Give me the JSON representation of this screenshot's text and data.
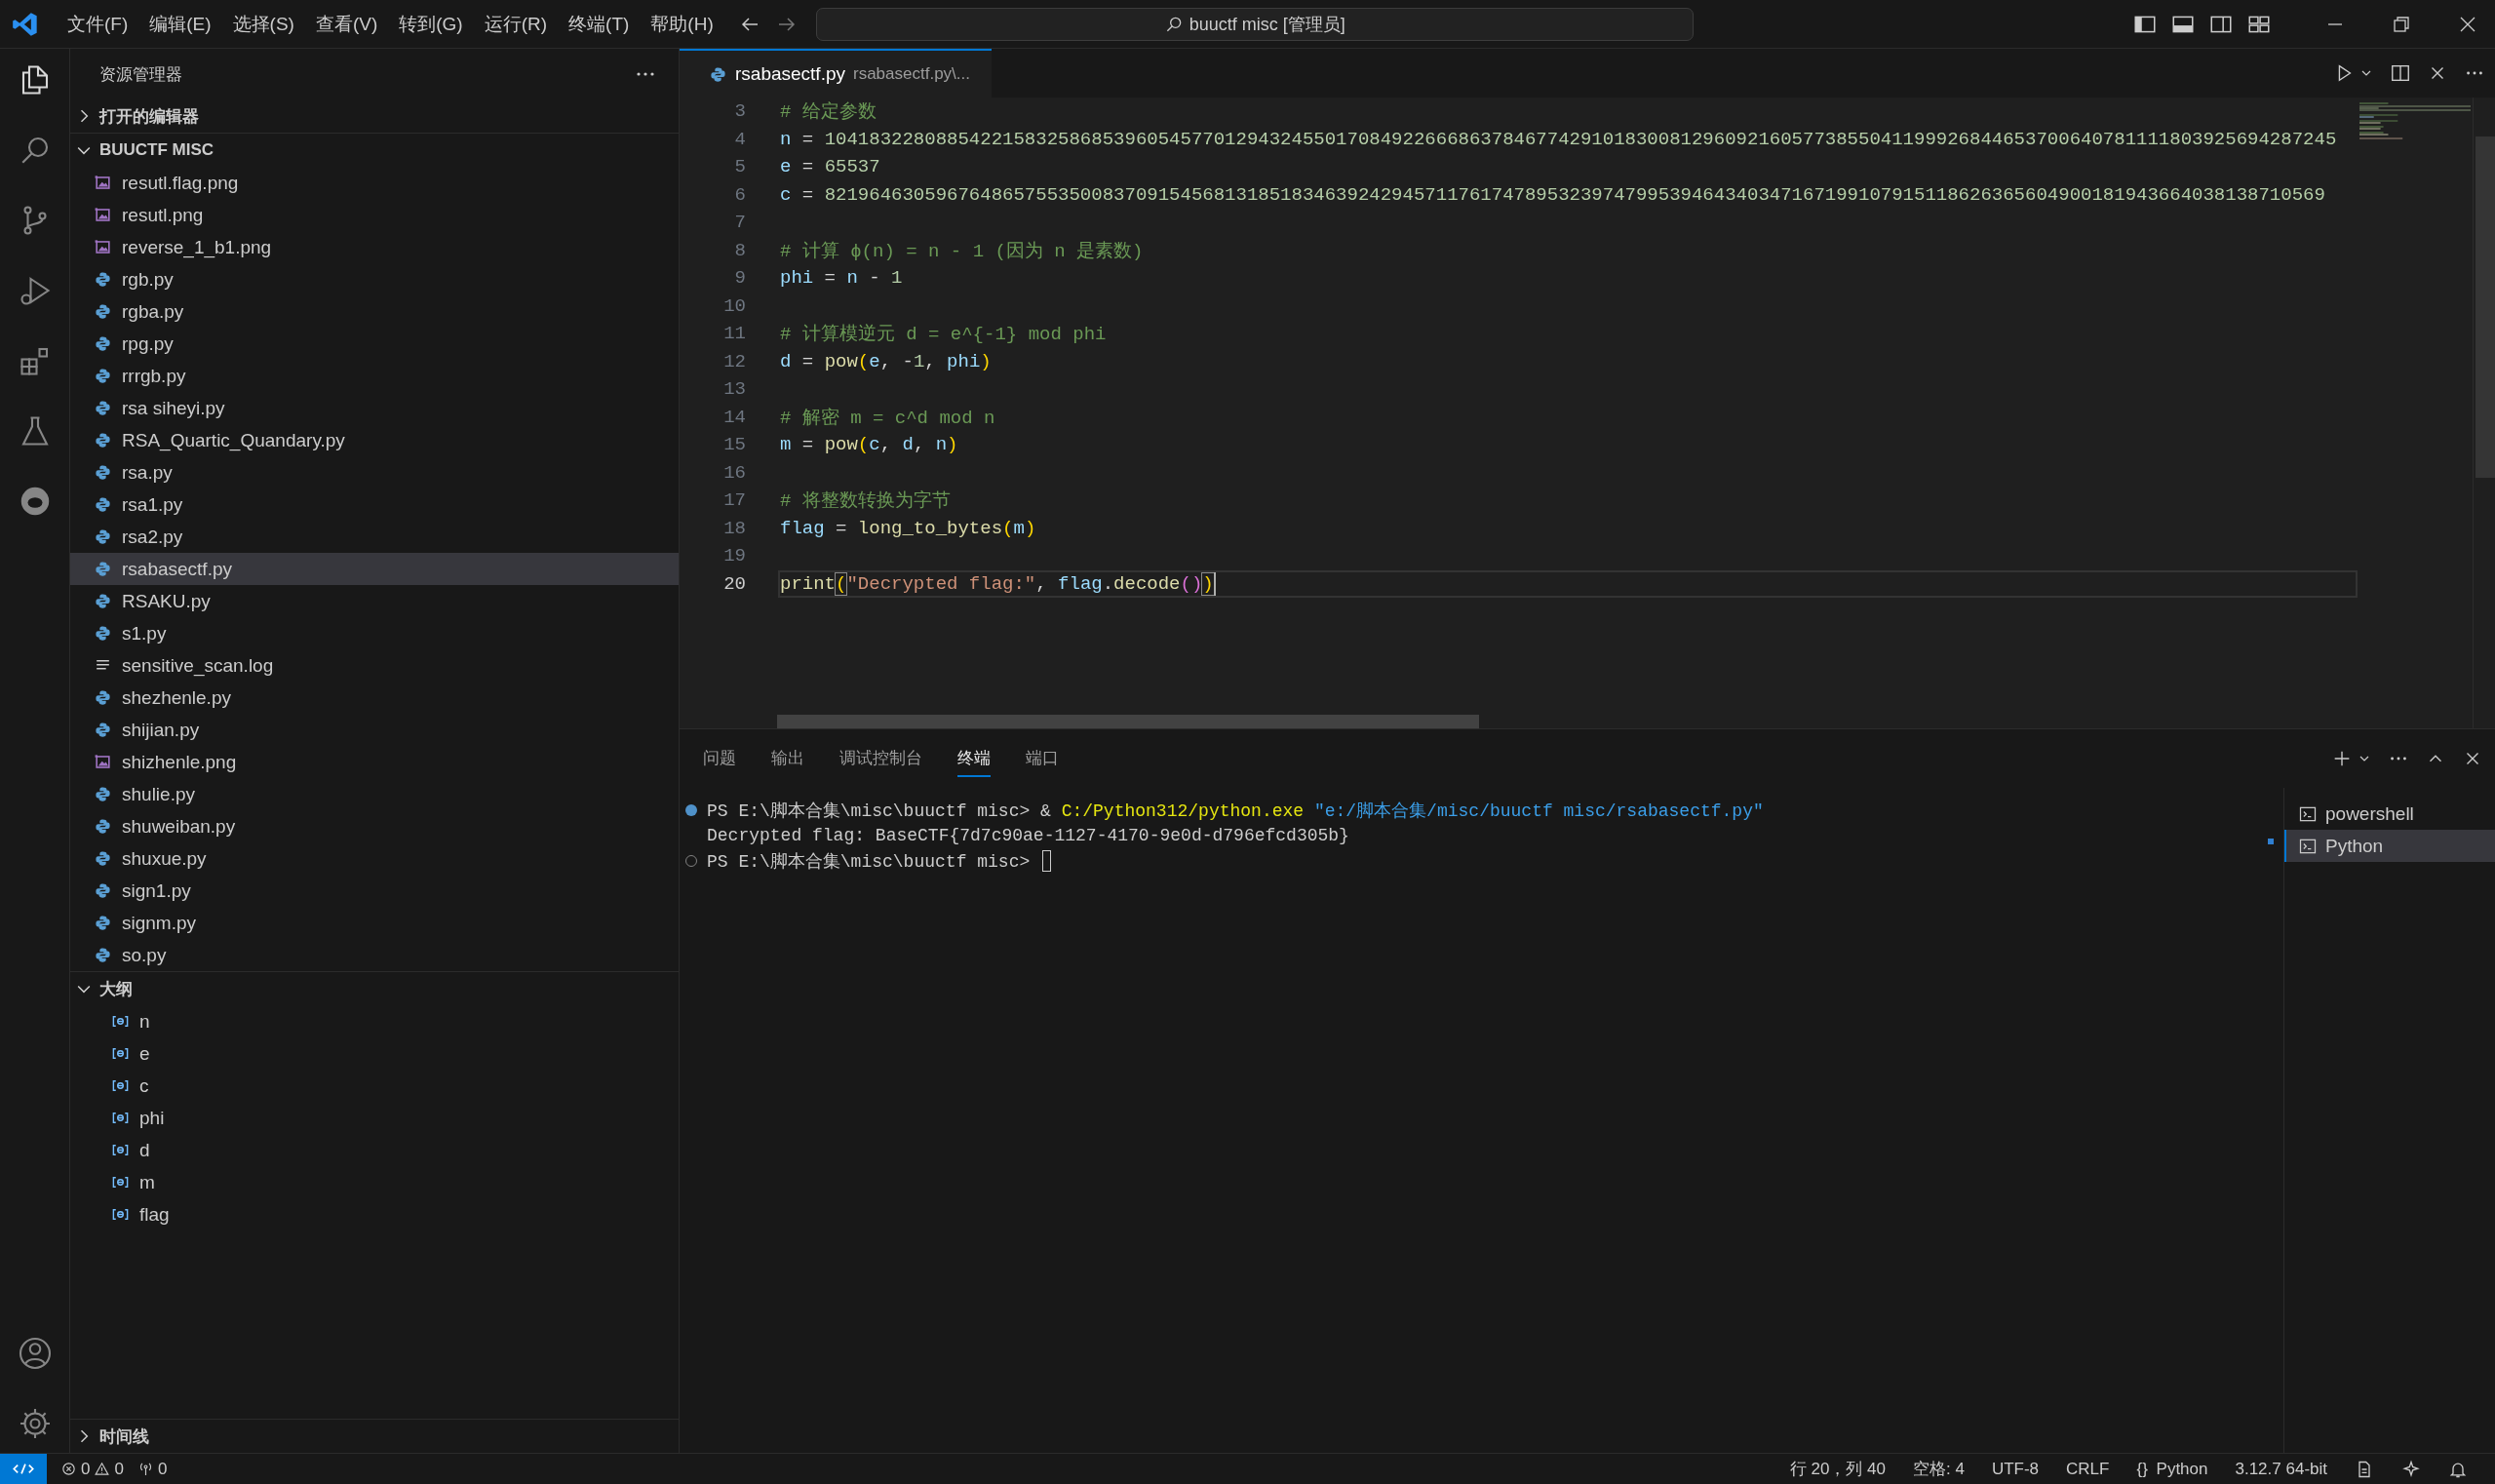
{
  "title_bar": {
    "menu": [
      "文件(F)",
      "编辑(E)",
      "选择(S)",
      "查看(V)",
      "转到(G)",
      "运行(R)",
      "终端(T)",
      "帮助(H)"
    ],
    "search": "buuctf misc [管理员]"
  },
  "activity_bar": {
    "top": [
      {
        "kind": "explorer",
        "selected": true
      },
      {
        "kind": "search",
        "selected": false
      },
      {
        "kind": "source-control",
        "selected": false
      },
      {
        "kind": "run-debug",
        "selected": false
      },
      {
        "kind": "extensions",
        "selected": false
      },
      {
        "kind": "testing",
        "selected": false
      },
      {
        "kind": "assistant",
        "selected": false
      }
    ],
    "bottom": [
      {
        "kind": "account",
        "selected": false
      },
      {
        "kind": "settings",
        "selected": false
      }
    ]
  },
  "sidebar": {
    "title": "资源管理器",
    "open_editors": {
      "label": "打开的编辑器",
      "expanded": false
    },
    "folder": {
      "label": "BUUCTF MISC",
      "expanded": true,
      "items": [
        {
          "name": "resutl.flag.png",
          "kind": "image",
          "selected": false
        },
        {
          "name": "resutl.png",
          "kind": "image",
          "selected": false
        },
        {
          "name": "reverse_1_b1.png",
          "kind": "image",
          "selected": false
        },
        {
          "name": "rgb.py",
          "kind": "python",
          "selected": false
        },
        {
          "name": "rgba.py",
          "kind": "python",
          "selected": false
        },
        {
          "name": "rpg.py",
          "kind": "python",
          "selected": false
        },
        {
          "name": "rrrgb.py",
          "kind": "python",
          "selected": false
        },
        {
          "name": "rsa siheyi.py",
          "kind": "python",
          "selected": false
        },
        {
          "name": "RSA_Quartic_Quandary.py",
          "kind": "python",
          "selected": false
        },
        {
          "name": "rsa.py",
          "kind": "python",
          "selected": false
        },
        {
          "name": "rsa1.py",
          "kind": "python",
          "selected": false
        },
        {
          "name": "rsa2.py",
          "kind": "python",
          "selected": false
        },
        {
          "name": "rsabasectf.py",
          "kind": "python",
          "selected": true
        },
        {
          "name": "RSAKU.py",
          "kind": "python",
          "selected": false
        },
        {
          "name": "s1.py",
          "kind": "python",
          "selected": false
        },
        {
          "name": "sensitive_scan.log",
          "kind": "log",
          "selected": false
        },
        {
          "name": "shezhenle.py",
          "kind": "python",
          "selected": false
        },
        {
          "name": "shijian.py",
          "kind": "python",
          "selected": false
        },
        {
          "name": "shizhenle.png",
          "kind": "image",
          "selected": false
        },
        {
          "name": "shulie.py",
          "kind": "python",
          "selected": false
        },
        {
          "name": "shuweiban.py",
          "kind": "python",
          "selected": false
        },
        {
          "name": "shuxue.py",
          "kind": "python",
          "selected": false
        },
        {
          "name": "sign1.py",
          "kind": "python",
          "selected": false
        },
        {
          "name": "signm.py",
          "kind": "python",
          "selected": false
        },
        {
          "name": "so.py",
          "kind": "python",
          "selected": false
        }
      ]
    },
    "outline": {
      "label": "大纲",
      "expanded": true,
      "items": [
        "n",
        "e",
        "c",
        "phi",
        "d",
        "m",
        "flag"
      ]
    },
    "timeline": {
      "label": "时间线",
      "expanded": false
    }
  },
  "editor": {
    "tab": {
      "name": "rsabasectf.py",
      "path": "rsabasectf.py\\..."
    },
    "lines": [
      {
        "number": "3",
        "current": false,
        "tokens": [
          {
            "text": "# 给定参数",
            "kind": "comment"
          }
        ]
      },
      {
        "number": "4",
        "current": false,
        "tokens": [
          {
            "text": "n",
            "kind": "var"
          },
          {
            "text": " = ",
            "kind": "op"
          },
          {
            "text": "1041832280885422158325868539605457701294324550170849226668637846774291018300812960921605773855041199926844653700640781111803925694287245",
            "kind": "num"
          }
        ]
      },
      {
        "number": "5",
        "current": false,
        "tokens": [
          {
            "text": "e",
            "kind": "var"
          },
          {
            "text": " = ",
            "kind": "op"
          },
          {
            "text": "65537",
            "kind": "num"
          }
        ]
      },
      {
        "number": "6",
        "current": false,
        "tokens": [
          {
            "text": "c",
            "kind": "var"
          },
          {
            "text": " = ",
            "kind": "op"
          },
          {
            "text": "821964630596764865755350083709154568131851834639242945711761747895323974799539464340347167199107915118626365604900181943664038138710569",
            "kind": "num"
          }
        ]
      },
      {
        "number": "7",
        "current": false
      },
      {
        "number": "8",
        "current": false,
        "tokens": [
          {
            "text": "# 计算 ϕ(n) = n - 1 (因为 n 是素数)",
            "kind": "comment"
          }
        ]
      },
      {
        "number": "9",
        "current": false,
        "tokens": [
          {
            "text": "phi",
            "kind": "var"
          },
          {
            "text": " = ",
            "kind": "op"
          },
          {
            "text": "n",
            "kind": "var"
          },
          {
            "text": " - ",
            "kind": "op"
          },
          {
            "text": "1",
            "kind": "num"
          }
        ]
      },
      {
        "number": "10",
        "current": false
      },
      {
        "number": "11",
        "current": false,
        "tokens": [
          {
            "text": "# 计算模逆元 d = e^{-1} mod phi",
            "kind": "comment"
          }
        ]
      },
      {
        "number": "12",
        "current": false,
        "tokens": [
          {
            "text": "d",
            "kind": "var"
          },
          {
            "text": " = ",
            "kind": "op"
          },
          {
            "text": "pow",
            "kind": "fn"
          },
          {
            "text": "(",
            "kind": "bracket"
          },
          {
            "text": "e",
            "kind": "var"
          },
          {
            "text": ", -",
            "kind": "op"
          },
          {
            "text": "1",
            "kind": "num"
          },
          {
            "text": ", ",
            "kind": "op"
          },
          {
            "text": "phi",
            "kind": "var"
          },
          {
            "text": ")",
            "kind": "bracket"
          }
        ]
      },
      {
        "number": "13",
        "current": false
      },
      {
        "number": "14",
        "current": false,
        "tokens": [
          {
            "text": "# 解密 m = c^d mod n",
            "kind": "comment"
          }
        ]
      },
      {
        "number": "15",
        "current": false,
        "tokens": [
          {
            "text": "m",
            "kind": "var"
          },
          {
            "text": " = ",
            "kind": "op"
          },
          {
            "text": "pow",
            "kind": "fn"
          },
          {
            "text": "(",
            "kind": "bracket"
          },
          {
            "text": "c",
            "kind": "var"
          },
          {
            "text": ", ",
            "kind": "op"
          },
          {
            "text": "d",
            "kind": "var"
          },
          {
            "text": ", ",
            "kind": "op"
          },
          {
            "text": "n",
            "kind": "var"
          },
          {
            "text": ")",
            "kind": "bracket"
          }
        ]
      },
      {
        "number": "16",
        "current": false
      },
      {
        "number": "17",
        "current": false,
        "tokens": [
          {
            "text": "# 将整数转换为字节",
            "kind": "comment"
          }
        ]
      },
      {
        "number": "18",
        "current": false,
        "tokens": [
          {
            "text": "flag",
            "kind": "var"
          },
          {
            "text": " = ",
            "kind": "op"
          },
          {
            "text": "long_to_bytes",
            "kind": "fn"
          },
          {
            "text": "(",
            "kind": "bracket"
          },
          {
            "text": "m",
            "kind": "var"
          },
          {
            "text": ")",
            "kind": "bracket"
          }
        ]
      },
      {
        "number": "19",
        "current": false
      },
      {
        "number": "20",
        "current": true,
        "tokens": [
          {
            "text": "print",
            "kind": "fn"
          },
          {
            "text": "(",
            "kind": "matched"
          },
          {
            "text": "\"Decrypted flag:\"",
            "kind": "str"
          },
          {
            "text": ", ",
            "kind": "op"
          },
          {
            "text": "flag",
            "kind": "var"
          },
          {
            "text": ".",
            "kind": "op"
          },
          {
            "text": "decode",
            "kind": "fn"
          },
          {
            "text": "()",
            "kind": "bracket2"
          },
          {
            "text": ")",
            "kind": "matched"
          }
        ]
      }
    ]
  },
  "panel": {
    "tabs": [
      {
        "label": "问题",
        "selected": false
      },
      {
        "label": "输出",
        "selected": false
      },
      {
        "label": "调试控制台",
        "selected": false
      },
      {
        "label": "终端",
        "selected": true
      },
      {
        "label": "端口",
        "selected": false
      }
    ],
    "terminal": [
      {
        "kind": "success",
        "cursor": false,
        "segments": [
          {
            "text": "PS E:\\脚本合集\\misc\\buuctf misc> & ",
            "kind": "plain"
          },
          {
            "text": "C:/Python312/python.exe",
            "kind": "exe"
          },
          {
            "text": " \"e:/脚本合集/misc/buuctf misc/rsabasectf.py\"",
            "kind": "str"
          }
        ]
      },
      {
        "kind": "none",
        "cursor": false,
        "segments": [
          {
            "text": "Decrypted flag: BaseCTF{7d7c90ae-1127-4170-9e0d-d796efcd305b}",
            "kind": "plain"
          }
        ]
      },
      {
        "kind": "pending",
        "cursor": true,
        "segments": [
          {
            "text": "PS E:\\脚本合集\\misc\\buuctf misc> ",
            "kind": "plain"
          }
        ]
      }
    ],
    "terminals": [
      {
        "name": "powershell",
        "selected": false
      },
      {
        "name": "Python",
        "selected": true
      }
    ]
  },
  "status_bar": {
    "errors": "0",
    "warnings": "0",
    "ports": "0",
    "position": "行 20，列 40",
    "indent": "空格: 4",
    "encoding": "UTF-8",
    "eol": "CRLF",
    "braces": "{}",
    "language": "Python",
    "interpreter": "3.12.7 64-bit"
  }
}
